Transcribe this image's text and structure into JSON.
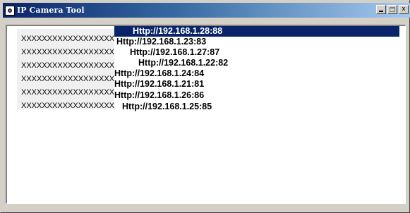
{
  "window": {
    "title": "IP Camera Tool"
  },
  "title_buttons": {
    "minimize_icon": "minimize-icon",
    "maximize_icon": "maximize-icon",
    "close_label": "x"
  },
  "colors": {
    "selection": "#0a246a",
    "titlebar_start": "#0a246a",
    "titlebar_end": "#a6caf0"
  },
  "cameras": [
    {
      "name": "XXXXXXXXXXXXXXXXXX",
      "url": "Http://192.168.1.28:88",
      "selected": true
    },
    {
      "name": "XXXXXXXXXXXXXXXXXX",
      "url": "Http://192.168.1.23:83",
      "selected": false
    },
    {
      "name": "XXXXXXXXXXXXXXXXXX",
      "url": "Http://192.168.1.27:87",
      "selected": false
    },
    {
      "name": "XXXXXXXXXXXXXXXXXX",
      "url": "Http://192.168.1.22:82",
      "selected": false
    },
    {
      "name": "XXXXXXXXXXXXXXXXXX",
      "url": "Http://192.168.1.24:84",
      "selected": false
    },
    {
      "name": "XXXXXXXXXXXXXXXXXX",
      "url": "Http://192.168.1.21:81",
      "selected": false
    },
    {
      "name": "XXXXXXXXXXXXXXXXXX",
      "url": "Http://192.168.1.26:86",
      "selected": false
    },
    {
      "name": "XXXXXXXXXXXXXXXXXX",
      "url": "Http://192.168.1.25:85",
      "selected": false
    }
  ]
}
